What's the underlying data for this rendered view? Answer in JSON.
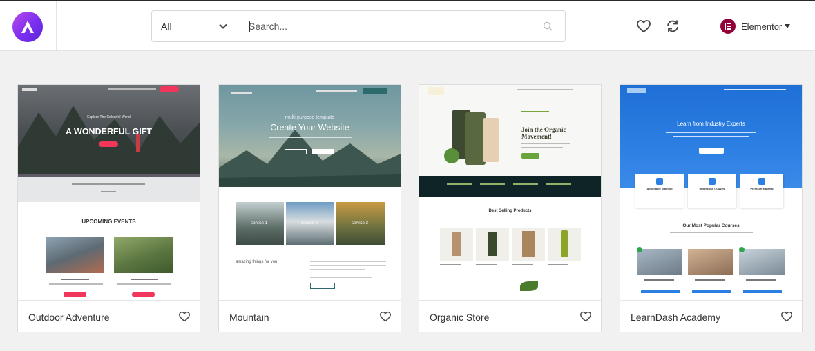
{
  "header": {
    "category_value": "All",
    "search_placeholder": "Search...",
    "builder_label": "Elementor"
  },
  "colors": {
    "brand_gradient_start": "#b94ae8",
    "brand_gradient_end": "#5a24d6",
    "elementor": "#92003b"
  },
  "icons": [
    "astra-logo-icon",
    "chevron-down-icon",
    "search-icon",
    "heart-icon",
    "sync-icon",
    "elementor-icon",
    "caret-down-icon"
  ],
  "templates": [
    {
      "title": "Outdoor Adventure",
      "preview": {
        "tagline": "Explore The Colourful World",
        "headline": "A WONDERFUL GIFT",
        "section": "UPCOMING EVENTS"
      }
    },
    {
      "title": "Mountain",
      "preview": {
        "tagline": "multi-purpose template",
        "headline": "Create Your Website",
        "tiles": [
          "service 1",
          "service 2",
          "service 3"
        ],
        "section": "amazing things for you"
      }
    },
    {
      "title": "Organic Store",
      "preview": {
        "headline": "Join the Organic Movement!",
        "section": "Best Selling Products"
      }
    },
    {
      "title": "LearnDash Academy",
      "preview": {
        "headline": "Learn from Industry Experts",
        "features": [
          "Actionable Training",
          "Interesting Quizzes",
          "Premium Material"
        ],
        "section": "Our Most Popular Courses"
      }
    }
  ]
}
